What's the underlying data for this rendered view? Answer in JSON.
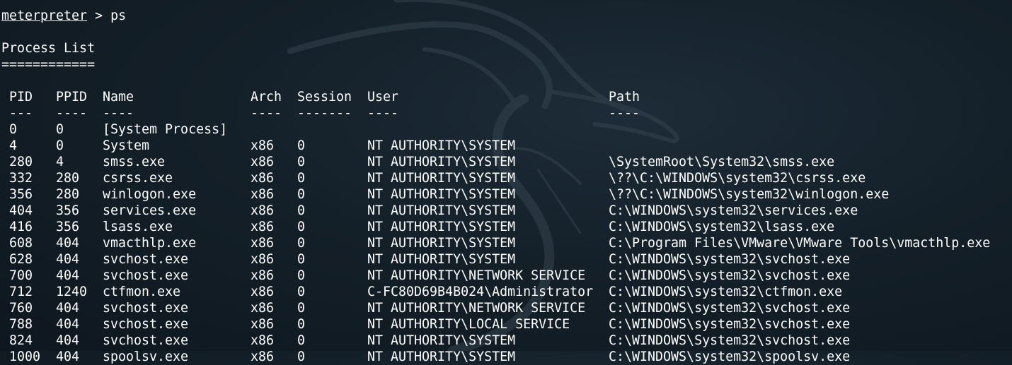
{
  "terminal": {
    "prompt": "meterpreter",
    "command": " > ps",
    "title": "Process List",
    "underline": "============"
  },
  "table": {
    "headers": [
      "PID",
      "PPID",
      "Name",
      "Arch",
      "Session",
      "User",
      "Path"
    ],
    "separators": [
      "---",
      "----",
      "----",
      "----",
      "-------",
      "----",
      "----"
    ],
    "rows": [
      [
        "0",
        "0",
        "[System Process]",
        "",
        "",
        "",
        ""
      ],
      [
        "4",
        "0",
        "System",
        "x86",
        "0",
        "NT AUTHORITY\\SYSTEM",
        ""
      ],
      [
        "280",
        "4",
        "smss.exe",
        "x86",
        "0",
        "NT AUTHORITY\\SYSTEM",
        "\\SystemRoot\\System32\\smss.exe"
      ],
      [
        "332",
        "280",
        "csrss.exe",
        "x86",
        "0",
        "NT AUTHORITY\\SYSTEM",
        "\\??\\C:\\WINDOWS\\system32\\csrss.exe"
      ],
      [
        "356",
        "280",
        "winlogon.exe",
        "x86",
        "0",
        "NT AUTHORITY\\SYSTEM",
        "\\??\\C:\\WINDOWS\\system32\\winlogon.exe"
      ],
      [
        "404",
        "356",
        "services.exe",
        "x86",
        "0",
        "NT AUTHORITY\\SYSTEM",
        "C:\\WINDOWS\\system32\\services.exe"
      ],
      [
        "416",
        "356",
        "lsass.exe",
        "x86",
        "0",
        "NT AUTHORITY\\SYSTEM",
        "C:\\WINDOWS\\system32\\lsass.exe"
      ],
      [
        "608",
        "404",
        "vmacthlp.exe",
        "x86",
        "0",
        "NT AUTHORITY\\SYSTEM",
        "C:\\Program Files\\VMware\\VMware Tools\\vmacthlp.exe"
      ],
      [
        "628",
        "404",
        "svchost.exe",
        "x86",
        "0",
        "NT AUTHORITY\\SYSTEM",
        "C:\\WINDOWS\\system32\\svchost.exe"
      ],
      [
        "700",
        "404",
        "svchost.exe",
        "x86",
        "0",
        "NT AUTHORITY\\NETWORK SERVICE",
        "C:\\WINDOWS\\system32\\svchost.exe"
      ],
      [
        "712",
        "1240",
        "ctfmon.exe",
        "x86",
        "0",
        "C-FC80D69B4B024\\Administrator",
        "C:\\WINDOWS\\system32\\ctfmon.exe"
      ],
      [
        "760",
        "404",
        "svchost.exe",
        "x86",
        "0",
        "NT AUTHORITY\\NETWORK SERVICE",
        "C:\\WINDOWS\\system32\\svchost.exe"
      ],
      [
        "788",
        "404",
        "svchost.exe",
        "x86",
        "0",
        "NT AUTHORITY\\LOCAL SERVICE",
        "C:\\WINDOWS\\system32\\svchost.exe"
      ],
      [
        "824",
        "404",
        "svchost.exe",
        "x86",
        "0",
        "NT AUTHORITY\\SYSTEM",
        "C:\\WINDOWS\\System32\\svchost.exe"
      ],
      [
        "1000",
        "404",
        "spoolsv.exe",
        "x86",
        "0",
        "NT AUTHORITY\\SYSTEM",
        "C:\\WINDOWS\\system32\\spoolsv.exe"
      ]
    ]
  }
}
